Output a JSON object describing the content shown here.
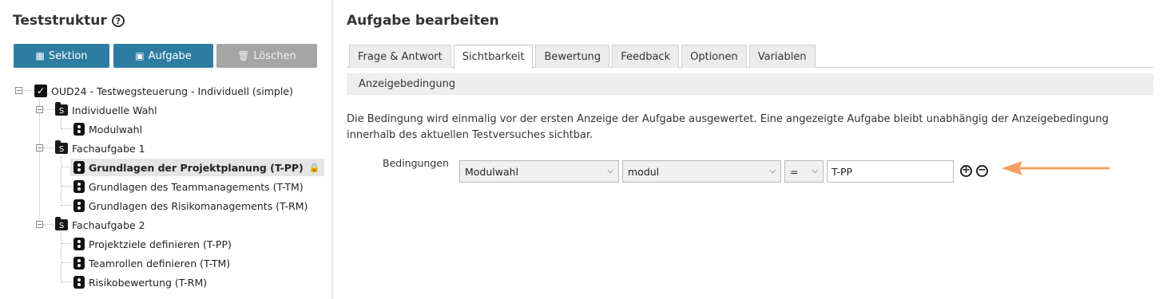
{
  "left_panel": {
    "title": "Teststruktur",
    "help_icon": "?",
    "buttons": {
      "sektion": "Sektion",
      "aufgabe": "Aufgabe",
      "loeschen": "Löschen"
    },
    "tree": {
      "root": "OUD24 - Testwegsteuerung - Individuell (simple)",
      "sections": [
        {
          "label": "Individuelle Wahl",
          "items": [
            "Modulwahl"
          ]
        },
        {
          "label": "Fachaufgabe 1",
          "items": [
            "Grundlagen der Projektplanung (T-PP)",
            "Grundlagen des Teammanagements (T-TM)",
            "Grundlagen des Risikomanagements (T-RM)"
          ]
        },
        {
          "label": "Fachaufgabe 2",
          "items": [
            "Projektziele definieren (T-PP)",
            "Teamrollen definieren (T-TM)",
            "Risikobewertung (T-RM)"
          ]
        }
      ],
      "selected_item": "Grundlagen der Projektplanung (T-PP)"
    }
  },
  "right_panel": {
    "title": "Aufgabe bearbeiten",
    "tabs": [
      "Frage & Antwort",
      "Sichtbarkeit",
      "Bewertung",
      "Feedback",
      "Optionen",
      "Variablen"
    ],
    "active_tab": "Sichtbarkeit",
    "section_header": "Anzeigebedingung",
    "description": "Die Bedingung wird einmalig vor der ersten Anzeige der Aufgabe ausgewertet. Eine angezeigte Aufgabe bleibt unabhängig der Anzeigebedingung innerhalb des aktuellen Testversuches sichtbar.",
    "condition": {
      "label": "Bedingungen",
      "module_select": "Modulwahl",
      "variable_select": "modul",
      "operator_select": "=",
      "value": "T-PP"
    }
  },
  "colors": {
    "primary_button": "#2d7da2",
    "disabled_button": "#a5a5a5",
    "arrow": "#f0a060"
  },
  "icons": [
    "help-icon",
    "section-icon",
    "task-icon",
    "check-icon",
    "trash-icon",
    "lock-icon",
    "plus-circle-icon",
    "minus-circle-icon",
    "chevron-down-icon",
    "arrow-annotation"
  ]
}
